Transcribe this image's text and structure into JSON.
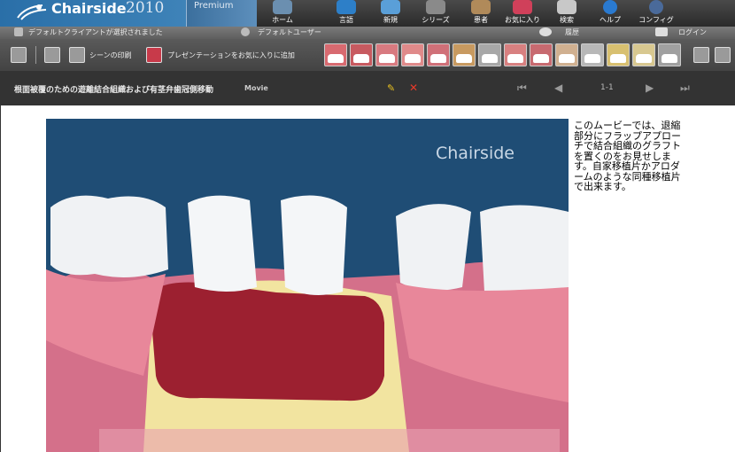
{
  "app": {
    "logo": "Chairside",
    "year": "2010",
    "edition": "Premium"
  },
  "nav": {
    "items": [
      {
        "label": "ホーム",
        "icon": "home-icon"
      },
      {
        "label": "言語",
        "icon": "language-icon"
      },
      {
        "label": "新規",
        "icon": "new-icon"
      },
      {
        "label": "シリーズ",
        "icon": "series-icon"
      },
      {
        "label": "患者",
        "icon": "patient-icon"
      },
      {
        "label": "お気に入り",
        "icon": "favorites-icon"
      },
      {
        "label": "検索",
        "icon": "search-icon"
      },
      {
        "label": "ヘルプ",
        "icon": "help-icon"
      },
      {
        "label": "コンフィグ",
        "icon": "config-icon"
      }
    ]
  },
  "status": {
    "client": "デフォルトクライアントが選択されました",
    "user": "デフォルトユーザー",
    "history": "履歴",
    "login": "ログイン"
  },
  "toolbar": {
    "print": "シーンの印刷",
    "add_favorite": "プレゼンテーションをお気に入りに追加"
  },
  "title": {
    "text": "根面被覆のための遊離結合組織および有茎弁歯冠側移動",
    "type": "Movie",
    "page": "1-1"
  },
  "content": {
    "watermark": "Chairside",
    "description": "このムービーでは、退縮部分にフラップアプローチで結合組織のグラフトを置くのをお見せします。自家移植片かアロダームのような同種移植片で出来ます。"
  },
  "colors": {
    "brand": "#2a6fa8",
    "video_bg": "#1f4d75",
    "gum": "#e8879a",
    "graft": "#9c2030"
  }
}
